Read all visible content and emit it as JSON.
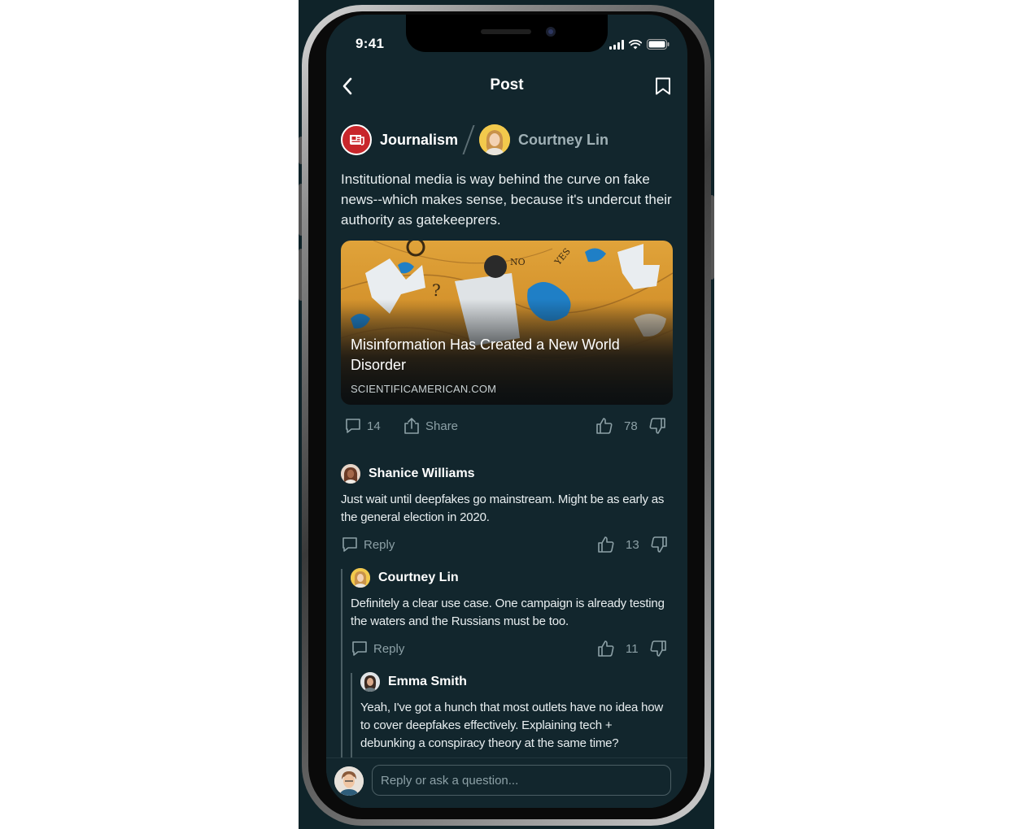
{
  "status_bar": {
    "time": "9:41"
  },
  "nav": {
    "title": "Post"
  },
  "post": {
    "community": "Journalism",
    "author": "Courtney Lin",
    "text": "Institutional media is way behind the curve on fake news--which makes sense, because it's undercut their authority as gatekeeprers.",
    "link": {
      "title": "Misinformation Has Created a New World Disorder",
      "domain": "SCIENTIFICAMERICAN.COM"
    },
    "comments_count": "14",
    "share_label": "Share",
    "score": "78"
  },
  "comments": [
    {
      "author": "Shanice Williams",
      "text": "Just wait until deepfakes go mainstream. Might be as early as the general election in 2020.",
      "reply_label": "Reply",
      "score": "13"
    },
    {
      "author": "Courtney Lin",
      "text": "Definitely a clear use case. One campaign is already testing the waters and the Russians must be too.",
      "reply_label": "Reply",
      "score": "11"
    },
    {
      "author": "Emma Smith",
      "text": "Yeah, I've got a hunch that most outlets have no idea how to cover deepfakes effectively. Explaining tech + debunking a conspiracy theory at the same time?"
    }
  ],
  "compose": {
    "placeholder": "Reply or ask a question..."
  },
  "colors": {
    "background": "#12262d",
    "muted": "#8ca0a6",
    "community_red": "#c8262b"
  }
}
